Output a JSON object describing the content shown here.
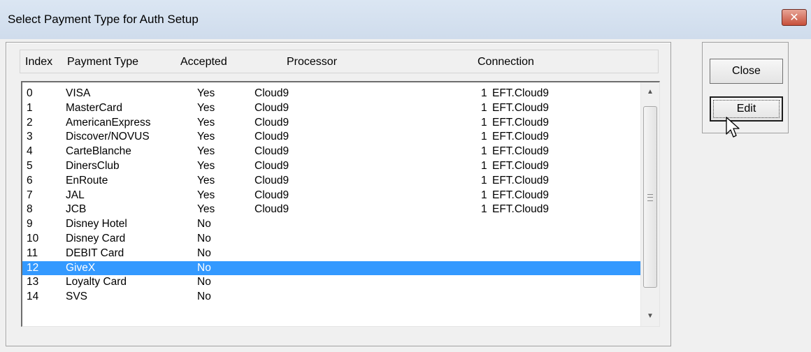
{
  "window": {
    "title": "Select Payment Type for Auth Setup",
    "close_glyph": "✕"
  },
  "columns": {
    "index": "Index",
    "payment_type": "Payment Type",
    "accepted": "Accepted",
    "processor": "Processor",
    "connection": "Connection"
  },
  "rows": [
    {
      "index": "0",
      "type": "VISA",
      "accepted": "Yes",
      "processor": "Cloud9",
      "conn_num": "1",
      "connection": "EFT.Cloud9"
    },
    {
      "index": "1",
      "type": "MasterCard",
      "accepted": "Yes",
      "processor": "Cloud9",
      "conn_num": "1",
      "connection": "EFT.Cloud9"
    },
    {
      "index": "2",
      "type": "AmericanExpress",
      "accepted": "Yes",
      "processor": "Cloud9",
      "conn_num": "1",
      "connection": "EFT.Cloud9"
    },
    {
      "index": "3",
      "type": "Discover/NOVUS",
      "accepted": "Yes",
      "processor": "Cloud9",
      "conn_num": "1",
      "connection": "EFT.Cloud9"
    },
    {
      "index": "4",
      "type": "CarteBlanche",
      "accepted": "Yes",
      "processor": "Cloud9",
      "conn_num": "1",
      "connection": "EFT.Cloud9"
    },
    {
      "index": "5",
      "type": "DinersClub",
      "accepted": "Yes",
      "processor": "Cloud9",
      "conn_num": "1",
      "connection": "EFT.Cloud9"
    },
    {
      "index": "6",
      "type": "EnRoute",
      "accepted": "Yes",
      "processor": "Cloud9",
      "conn_num": "1",
      "connection": "EFT.Cloud9"
    },
    {
      "index": "7",
      "type": "JAL",
      "accepted": "Yes",
      "processor": "Cloud9",
      "conn_num": "1",
      "connection": "EFT.Cloud9"
    },
    {
      "index": "8",
      "type": "JCB",
      "accepted": "Yes",
      "processor": "Cloud9",
      "conn_num": "1",
      "connection": "EFT.Cloud9"
    },
    {
      "index": "9",
      "type": "Disney Hotel",
      "accepted": "No",
      "processor": "",
      "conn_num": "",
      "connection": ""
    },
    {
      "index": "10",
      "type": "Disney Card",
      "accepted": "No",
      "processor": "",
      "conn_num": "",
      "connection": ""
    },
    {
      "index": "11",
      "type": "DEBIT Card",
      "accepted": "No",
      "processor": "",
      "conn_num": "",
      "connection": ""
    },
    {
      "index": "12",
      "type": "GiveX",
      "accepted": "No",
      "processor": "",
      "conn_num": "",
      "connection": "",
      "selected": true
    },
    {
      "index": "13",
      "type": "Loyalty Card",
      "accepted": "No",
      "processor": "",
      "conn_num": "",
      "connection": ""
    },
    {
      "index": "14",
      "type": "SVS",
      "accepted": "No",
      "processor": "",
      "conn_num": "",
      "connection": ""
    }
  ],
  "buttons": {
    "close": "Close",
    "edit": "Edit"
  },
  "icons": {
    "scroll_up": "▲",
    "scroll_down": "▼"
  },
  "colors": {
    "selection": "#3399ff",
    "close_button": "#c7503b"
  }
}
